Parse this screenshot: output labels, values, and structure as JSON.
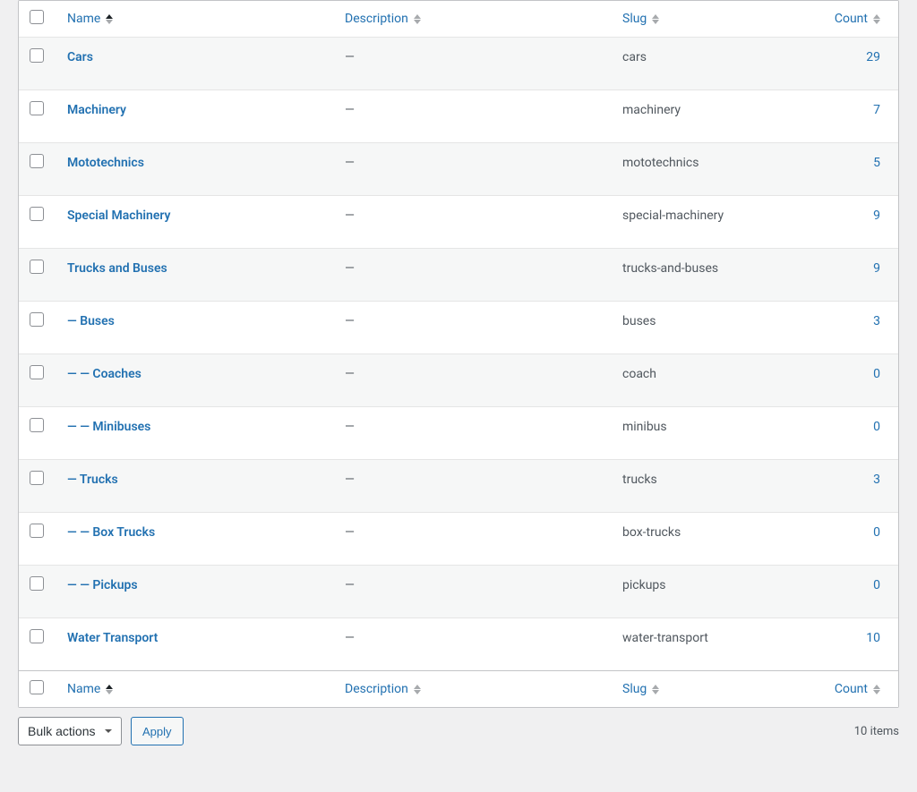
{
  "columns": {
    "name": "Name",
    "description": "Description",
    "slug": "Slug",
    "count": "Count"
  },
  "rows": [
    {
      "name": "Cars",
      "indent": 0,
      "description": "—",
      "slug": "cars",
      "count": "29"
    },
    {
      "name": "Machinery",
      "indent": 0,
      "description": "—",
      "slug": "machinery",
      "count": "7"
    },
    {
      "name": "Mototechnics",
      "indent": 0,
      "description": "—",
      "slug": "mototechnics",
      "count": "5"
    },
    {
      "name": "Special Machinery",
      "indent": 0,
      "description": "—",
      "slug": "special-machinery",
      "count": "9"
    },
    {
      "name": "Trucks and Buses",
      "indent": 0,
      "description": "—",
      "slug": "trucks-and-buses",
      "count": "9"
    },
    {
      "name": "Buses",
      "indent": 1,
      "description": "—",
      "slug": "buses",
      "count": "3"
    },
    {
      "name": "Coaches",
      "indent": 2,
      "description": "—",
      "slug": "coach",
      "count": "0"
    },
    {
      "name": "Minibuses",
      "indent": 2,
      "description": "—",
      "slug": "minibus",
      "count": "0"
    },
    {
      "name": "Trucks",
      "indent": 1,
      "description": "—",
      "slug": "trucks",
      "count": "3"
    },
    {
      "name": "Box Trucks",
      "indent": 2,
      "description": "—",
      "slug": "box-trucks",
      "count": "0"
    },
    {
      "name": "Pickups",
      "indent": 2,
      "description": "—",
      "slug": "pickups",
      "count": "0"
    },
    {
      "name": "Water Transport",
      "indent": 0,
      "description": "—",
      "slug": "water-transport",
      "count": "10"
    }
  ],
  "footer": {
    "bulk_actions_label": "Bulk actions",
    "apply_label": "Apply",
    "items_count": "10 items"
  }
}
